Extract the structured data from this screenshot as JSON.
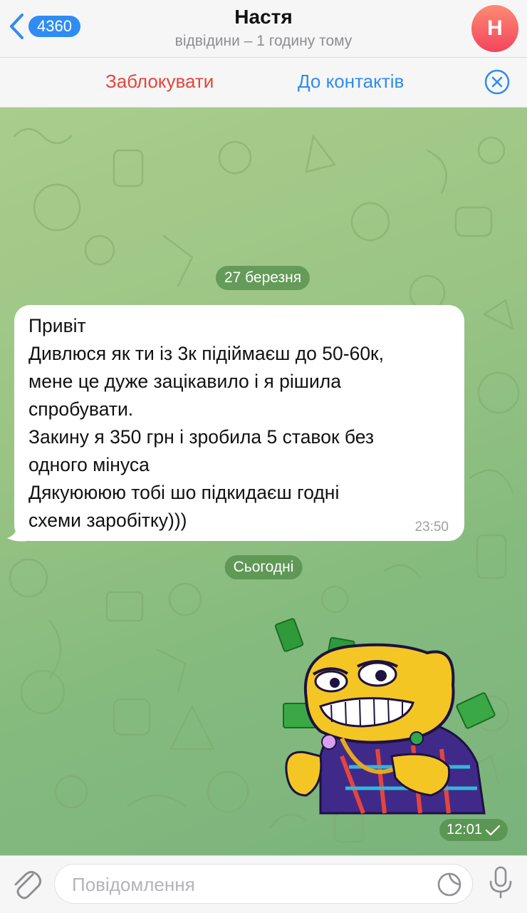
{
  "header": {
    "back_count": "4360",
    "title": "Настя",
    "status": "відвідини – 1 годину тому",
    "avatar_letter": "Н"
  },
  "actions": {
    "block": "Заблокувати",
    "add_contact": "До контактів"
  },
  "chat": {
    "date1": "27 березня",
    "message": {
      "lines": [
        "Привіт",
        "Дивлюся як ти із 3к підіймаєш до 50-60к,",
        "мене це дуже зацікавило і я рішила",
        "спробувати.",
        "Закину я 350 грн і зробила 5 ставок без",
        "одного мінуса",
        "Дякуюююю тобі шо підкидаєш годні",
        "схеми заробітку)))"
      ],
      "time": "23:50"
    },
    "date2": "Сьогодні",
    "sticker": {
      "icon": "money-emoji-sticker",
      "time": "12:01"
    }
  },
  "input": {
    "placeholder": "Повідомлення"
  },
  "colors": {
    "accent": "#2f8cf3",
    "danger": "#e4453c",
    "chat_bg": "#9bc585"
  }
}
